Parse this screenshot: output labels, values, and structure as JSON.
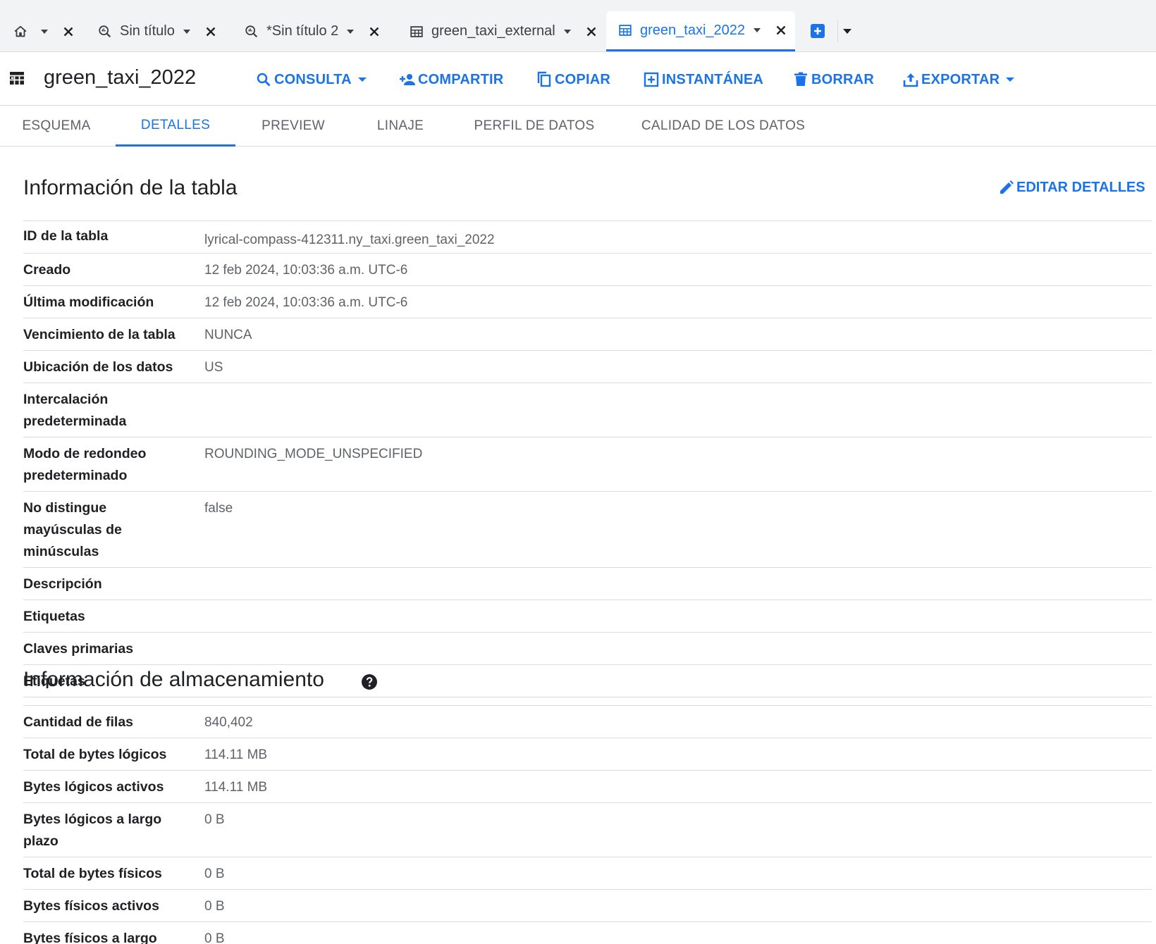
{
  "tabs": [
    {
      "label": "",
      "icon": "home-icon",
      "has_caret": true,
      "closable": true,
      "active": false
    },
    {
      "label": "Sin título",
      "icon": "query-icon",
      "has_caret": true,
      "closable": true,
      "active": false
    },
    {
      "label": "*Sin título 2",
      "icon": "query-icon",
      "has_caret": true,
      "closable": true,
      "active": false
    },
    {
      "label": "green_taxi_external",
      "icon": "table-icon",
      "has_caret": true,
      "closable": true,
      "active": false
    },
    {
      "label": "green_taxi_2022",
      "icon": "table-icon",
      "has_caret": true,
      "closable": true,
      "active": true
    }
  ],
  "toolbar": {
    "title": "green_taxi_2022",
    "buttons": [
      {
        "label": "CONSULTA",
        "icon": "search-icon",
        "has_caret": true
      },
      {
        "label": "COMPARTIR",
        "icon": "person-add-icon",
        "has_caret": false
      },
      {
        "label": "COPIAR",
        "icon": "copy-icon",
        "has_caret": false
      },
      {
        "label": "INSTANTÁNEA",
        "icon": "snapshot-icon",
        "has_caret": false
      },
      {
        "label": "BORRAR",
        "icon": "trash-icon",
        "has_caret": false
      },
      {
        "label": "EXPORTAR",
        "icon": "export-icon",
        "has_caret": true
      }
    ]
  },
  "subtabs": [
    {
      "label": "ESQUEMA",
      "active": false
    },
    {
      "label": "DETALLES",
      "active": true
    },
    {
      "label": "PREVIEW",
      "active": false
    },
    {
      "label": "LINAJE",
      "active": false
    },
    {
      "label": "PERFIL DE DATOS",
      "active": false
    },
    {
      "label": "CALIDAD DE LOS DATOS",
      "active": false
    }
  ],
  "table_info": {
    "title": "Información de la tabla",
    "edit_label": "EDITAR DETALLES",
    "rows": [
      {
        "key": "ID de la tabla",
        "value": "lyrical-compass-412311.ny_taxi.green_taxi_2022"
      },
      {
        "key": "Creado",
        "value": "12 feb 2024, 10:03:36 a.m. UTC-6"
      },
      {
        "key": "Última modificación",
        "value": "12 feb 2024, 10:03:36 a.m. UTC-6"
      },
      {
        "key": "Vencimiento de la tabla",
        "value": "NUNCA"
      },
      {
        "key": "Ubicación de los datos",
        "value": "US"
      },
      {
        "key": "Intercalación predeterminada",
        "value": ""
      },
      {
        "key": "Modo de redondeo predeterminado",
        "value": "ROUNDING_MODE_UNSPECIFIED"
      },
      {
        "key": "No distingue mayúsculas de minúsculas",
        "value": "false"
      },
      {
        "key": "Descripción",
        "value": ""
      },
      {
        "key": "Etiquetas",
        "value": ""
      },
      {
        "key": "Claves primarias",
        "value": ""
      },
      {
        "key": "Etiquetas",
        "value": ""
      }
    ]
  },
  "storage_info": {
    "title": "Información de almacenamiento",
    "rows": [
      {
        "key": "Cantidad de filas",
        "value": "840,402"
      },
      {
        "key": "Total de bytes lógicos",
        "value": "114.11 MB"
      },
      {
        "key": "Bytes lógicos activos",
        "value": "114.11 MB"
      },
      {
        "key": "Bytes lógicos a largo plazo",
        "value": "0 B"
      },
      {
        "key": "Total de bytes físicos",
        "value": "0 B"
      },
      {
        "key": "Bytes físicos activos",
        "value": "0 B"
      },
      {
        "key": "Bytes físicos a largo plazo",
        "value": "0 B"
      }
    ]
  },
  "colors": {
    "accent": "#1a73e8",
    "text": "#202124",
    "muted": "#5f6368",
    "divider": "#dadce0",
    "tabstrip_bg": "#f1f3f4"
  }
}
